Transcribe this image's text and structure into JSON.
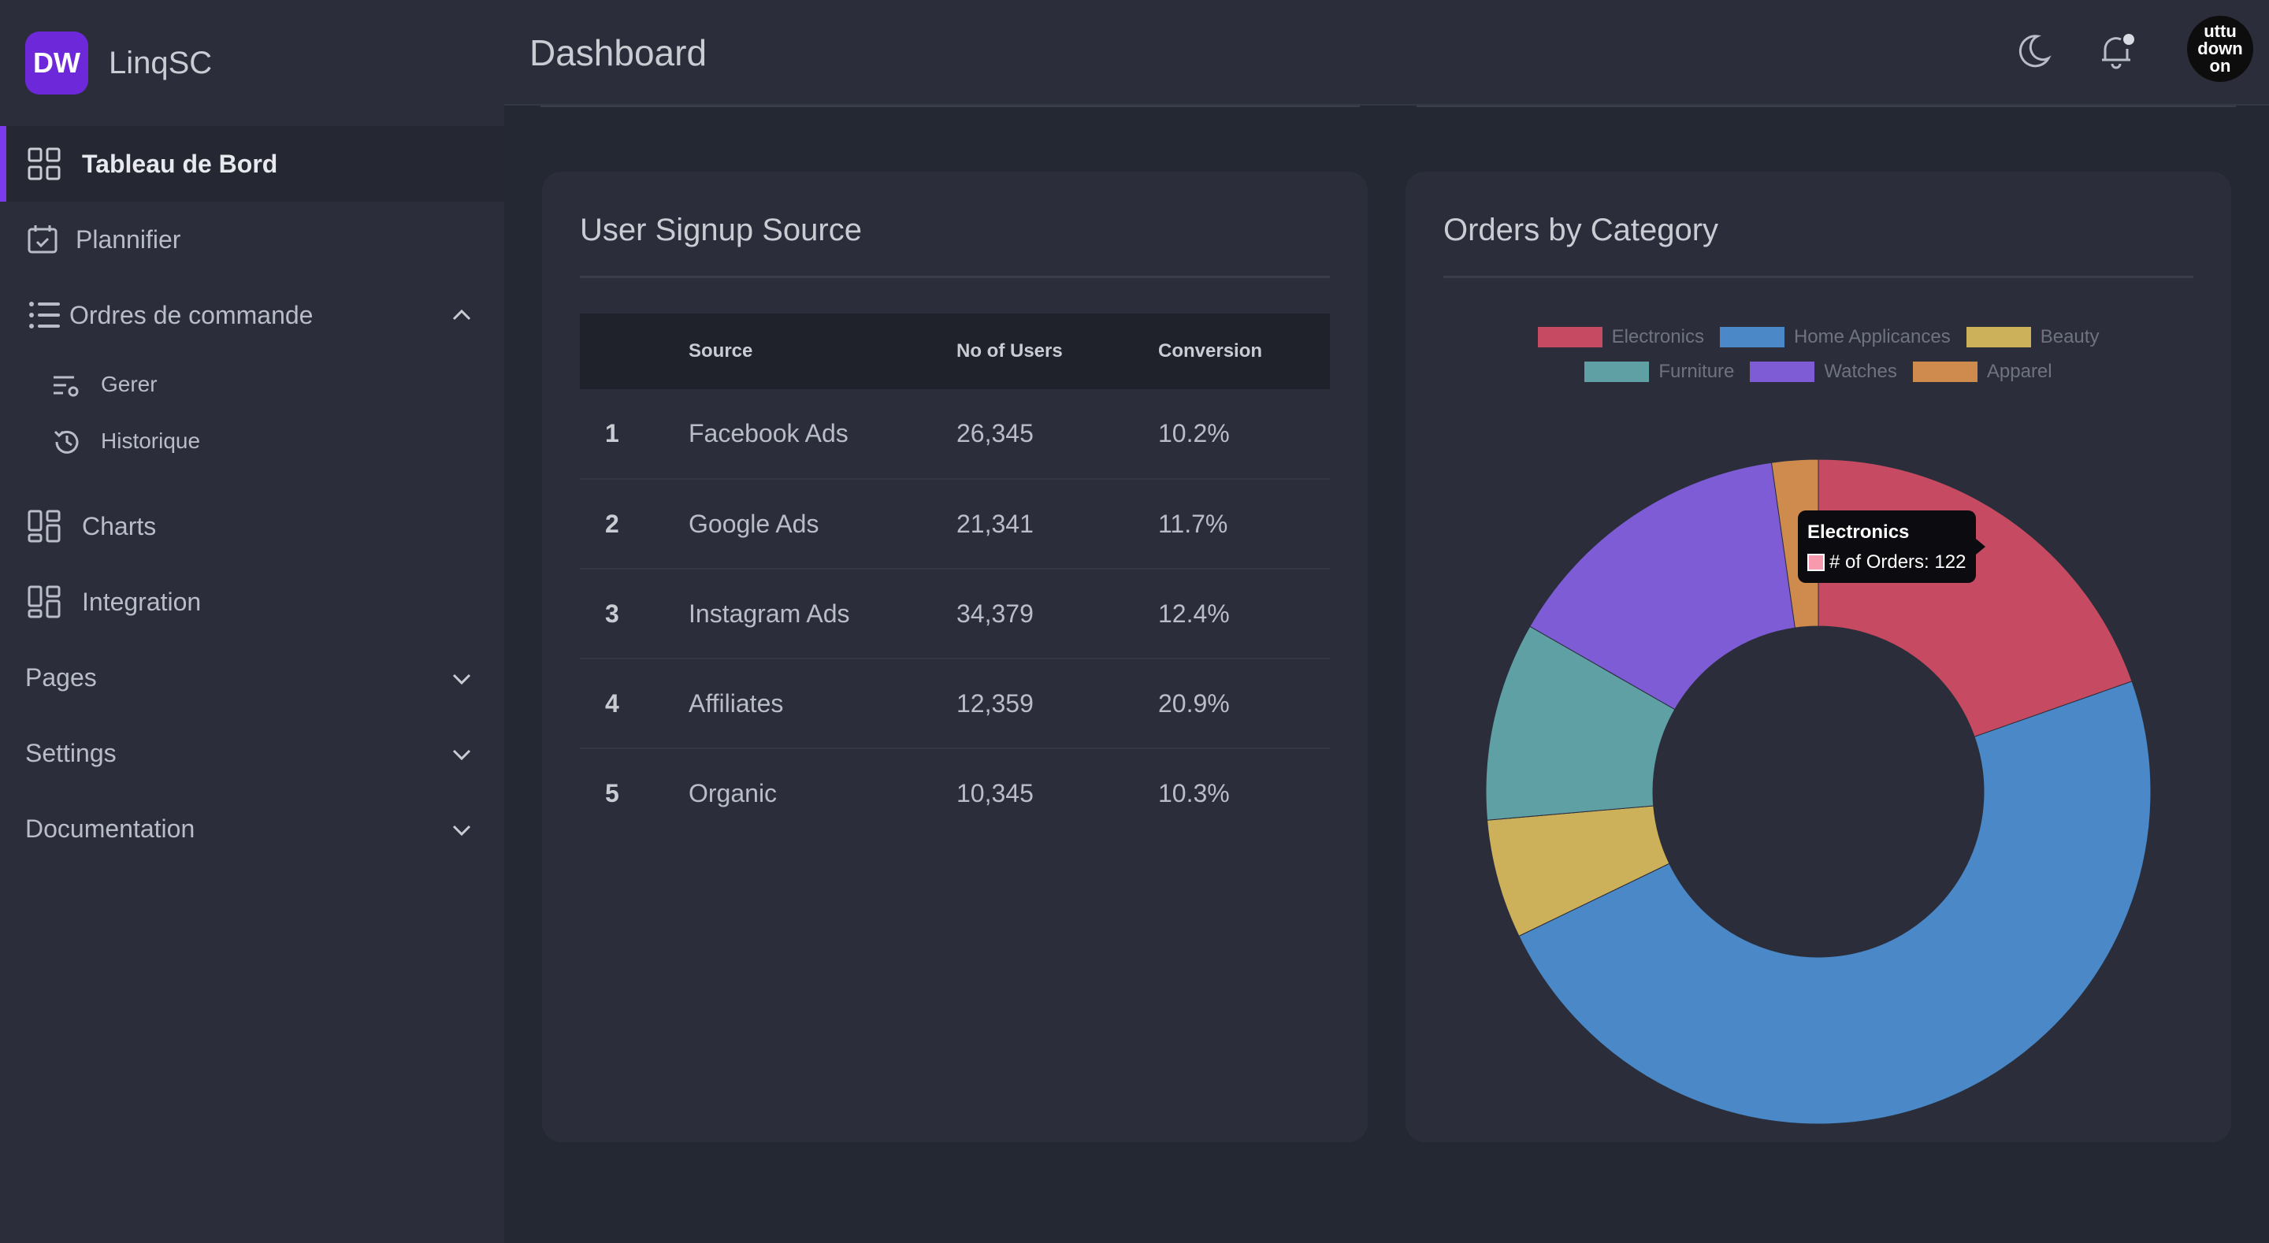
{
  "brand": {
    "logo_text": "DW",
    "name": "LinqSC"
  },
  "header": {
    "title": "Dashboard"
  },
  "sidebar": {
    "items": [
      {
        "label": "Tableau de Bord"
      },
      {
        "label": "Plannifier"
      },
      {
        "label": "Ordres de commande"
      },
      {
        "label": "Charts"
      },
      {
        "label": "Integration"
      },
      {
        "label": "Pages"
      },
      {
        "label": "Settings"
      },
      {
        "label": "Documentation"
      }
    ],
    "sub_items": [
      {
        "label": "Gerer"
      },
      {
        "label": "Historique"
      }
    ]
  },
  "avatar": {
    "lines": [
      "uttu",
      "down",
      "on"
    ]
  },
  "signup": {
    "title": "User Signup Source",
    "columns": [
      "",
      "Source",
      "No of Users",
      "Conversion"
    ],
    "rows": [
      [
        "1",
        "Facebook Ads",
        "26,345",
        "10.2%"
      ],
      [
        "2",
        "Google Ads",
        "21,341",
        "11.7%"
      ],
      [
        "3",
        "Instagram Ads",
        "34,379",
        "12.4%"
      ],
      [
        "4",
        "Affiliates",
        "12,359",
        "20.9%"
      ],
      [
        "5",
        "Organic",
        "10,345",
        "10.3%"
      ]
    ]
  },
  "orders": {
    "title": "Orders by Category",
    "tooltip": {
      "title": "Electronics",
      "line": "# of Orders: 122"
    }
  },
  "chart_data": {
    "type": "pie",
    "title": "Orders by Category",
    "categories": [
      "Electronics",
      "Home Applicances",
      "Beauty",
      "Furniture",
      "Watches",
      "Apparel"
    ],
    "values": [
      122,
      300,
      36,
      60,
      90,
      14
    ],
    "colors": [
      "#c54a62",
      "#4a88c7",
      "#cdb05a",
      "#5fa0a5",
      "#7d5cd6",
      "#cf8b4e"
    ],
    "legend": "top-center"
  }
}
